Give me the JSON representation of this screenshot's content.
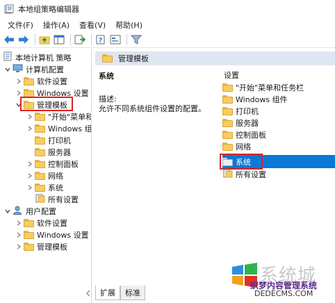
{
  "window": {
    "title": "本地组策略编辑器"
  },
  "menu": [
    "文件(F)",
    "操作(A)",
    "查看(V)",
    "帮助(H)"
  ],
  "toolbar": {
    "buttons": [
      "back-icon",
      "forward-icon",
      "up-folder-icon",
      "show-hide-tree-icon",
      "export-list-icon",
      "help-icon",
      "properties-icon",
      "filter-icon"
    ]
  },
  "tree": {
    "items": [
      {
        "label": "本地计算机 策略",
        "level": 0,
        "expander": ""
      },
      {
        "label": "计算机配置",
        "level": 1,
        "expander": "expanded"
      },
      {
        "label": "软件设置",
        "level": 2,
        "expander": "collapsed"
      },
      {
        "label": "Windows 设置",
        "level": 2,
        "expander": "collapsed"
      },
      {
        "label": "管理模板",
        "level": 2,
        "expander": "expanded",
        "highlighted": true
      },
      {
        "label": "\"开始\"菜单和",
        "level": 3,
        "expander": "collapsed"
      },
      {
        "label": "Windows 组",
        "level": 3,
        "expander": "collapsed"
      },
      {
        "label": "打印机",
        "level": 3,
        "expander": ""
      },
      {
        "label": "服务器",
        "level": 3,
        "expander": ""
      },
      {
        "label": "控制面板",
        "level": 3,
        "expander": "collapsed"
      },
      {
        "label": "网络",
        "level": 3,
        "expander": "collapsed"
      },
      {
        "label": "系统",
        "level": 3,
        "expander": "collapsed"
      },
      {
        "label": "所有设置",
        "level": 3,
        "expander": ""
      },
      {
        "label": "用户配置",
        "level": 1,
        "expander": "expanded"
      },
      {
        "label": "软件设置",
        "level": 2,
        "expander": "collapsed"
      },
      {
        "label": "Windows 设置",
        "level": 2,
        "expander": "collapsed"
      },
      {
        "label": "管理模板",
        "level": 2,
        "expander": "collapsed"
      }
    ]
  },
  "content": {
    "header": "管理模板",
    "detail_title": "系统",
    "detail_label": "描述:",
    "detail_text": "允许不同系统组件设置的配置。",
    "list_header": "设置",
    "list": [
      {
        "label": "\"开始\"菜单和任务栏"
      },
      {
        "label": "Windows 组件"
      },
      {
        "label": "打印机"
      },
      {
        "label": "服务器"
      },
      {
        "label": "控制面板"
      },
      {
        "label": "网络"
      },
      {
        "label": "系统",
        "selected": true
      },
      {
        "label": "所有设置"
      }
    ]
  },
  "tabs": [
    "扩展",
    "标准"
  ],
  "watermark": {
    "brand": "系统城",
    "line1": "织梦内容管理系统",
    "line2": "DEDECMS.COM"
  },
  "colors": {
    "selection": "#0a78d7",
    "highlight": "#e02020",
    "folder": "#f6cd62",
    "header_band": "#dfe6f1"
  }
}
